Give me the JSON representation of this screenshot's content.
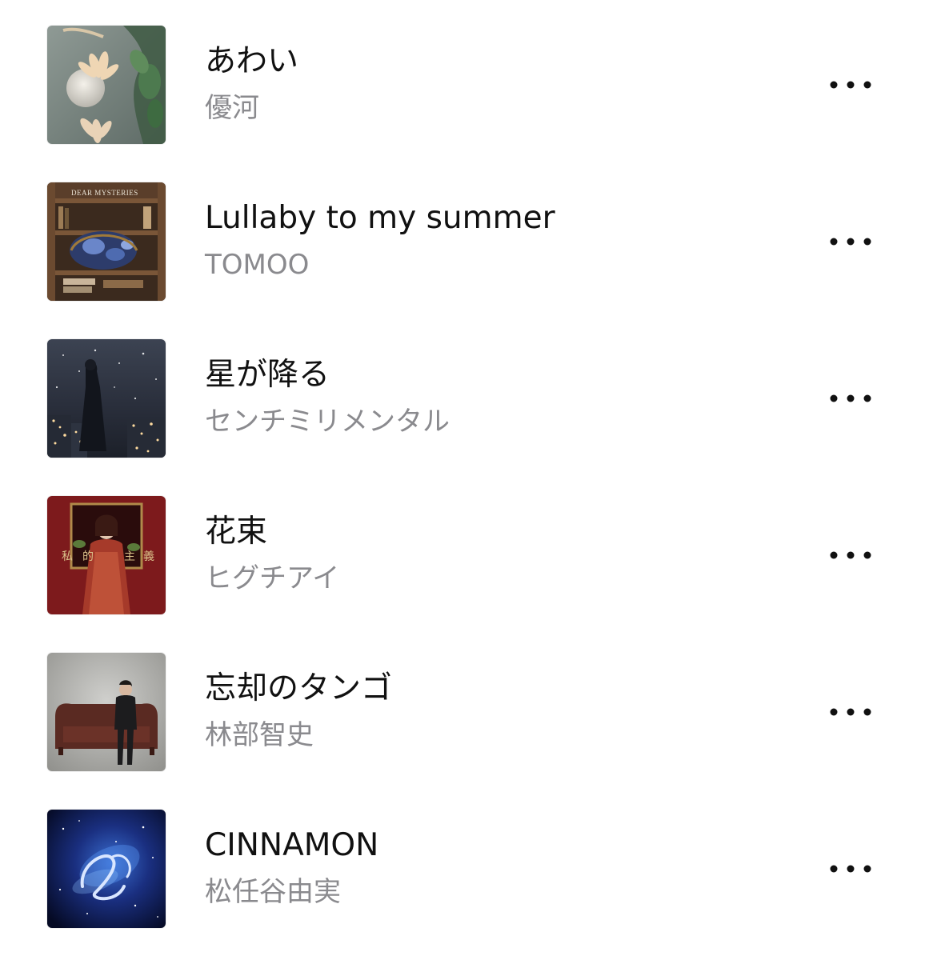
{
  "songs": [
    {
      "title": "あわい",
      "artist": "優河",
      "artwork": "moon-flower-artwork"
    },
    {
      "title": "Lullaby to my summer",
      "artist": "TOMOO",
      "artwork": "bookshelf-artwork",
      "artwork_text": "DEAR MYSTERIES"
    },
    {
      "title": "星が降る",
      "artist": "センチミリメンタル",
      "artwork": "night-city-artwork"
    },
    {
      "title": "花束",
      "artist": "ヒグチアイ",
      "artwork": "red-frame-artwork",
      "artwork_text": "私 的 主 義"
    },
    {
      "title": "忘却のタンゴ",
      "artist": "林部智史",
      "artwork": "sofa-portrait-artwork"
    },
    {
      "title": "CINNAMON",
      "artist": "松任谷由実",
      "artwork": "galaxy-artwork"
    }
  ],
  "more_icon": "ellipsis-icon",
  "colors": {
    "title": "#111111",
    "artist": "#8a8a8e",
    "background": "#ffffff",
    "icon": "#111111"
  }
}
